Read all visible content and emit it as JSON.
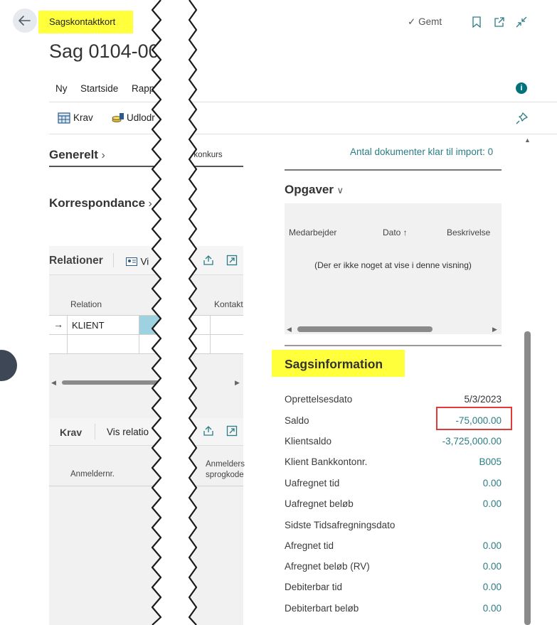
{
  "header": {
    "back_icon": "arrow-left-icon",
    "breadcrumb_label": "Sagskontaktkort",
    "title": "Sag 0104-00",
    "saved_label": "Gemt",
    "check_icon": "check-icon",
    "bookmark_icon": "bookmark-icon",
    "open_new_icon": "open-in-new-window-icon",
    "collapse_icon": "collapse-icon",
    "info_icon": "info-icon"
  },
  "nav": {
    "items": [
      "Ny",
      "Startside",
      "Rapp"
    ]
  },
  "actions": {
    "krav_label": "Krav",
    "udlodning_label": "Udlodr",
    "pin_icon": "pin-icon"
  },
  "sections": {
    "generelt": "Generelt",
    "korrespondance": "Korrespondance",
    "konkurs_fragment": "er konkurs"
  },
  "relationer": {
    "title": "Relationer",
    "vis_label": "Vi",
    "share_icon": "share-icon",
    "expand_icon": "expand-icon",
    "columns": [
      "Relation",
      "Kontakt"
    ],
    "rows": [
      {
        "relation": "KLIENT"
      }
    ]
  },
  "krav_section": {
    "title": "Krav",
    "vis_relation_label": "Vis relatio",
    "columns": [
      "Anmeldernr.",
      "Anmelders",
      "sprogkode"
    ]
  },
  "import_status": "Antal dokumenter klar til import: 0",
  "opgaver": {
    "title": "Opgaver",
    "columns": [
      "Medarbejder",
      "Dato ↑",
      "Beskrivelse"
    ],
    "empty_text": "(Der er ikke noget at vise i denne visning)"
  },
  "sagsinformation": {
    "title": "Sagsinformation",
    "fields": [
      {
        "label": "Oprettelsesdato",
        "value": "5/3/2023"
      },
      {
        "label": "Saldo",
        "value": "-75,000.00"
      },
      {
        "label": "Klientsaldo",
        "value": "-3,725,000.00"
      },
      {
        "label": "Klient Bankkontonr.",
        "value": "B005"
      },
      {
        "label": "Uafregnet tid",
        "value": "0.00"
      },
      {
        "label": "Uafregnet beløb",
        "value": "0.00"
      },
      {
        "label": "Sidste Tidsafregningsdato",
        "value": ""
      },
      {
        "label": "Afregnet tid",
        "value": "0.00"
      },
      {
        "label": "Afregnet beløb (RV)",
        "value": "0.00"
      },
      {
        "label": "Debiterbar tid",
        "value": "0.00"
      },
      {
        "label": "Debiterbart beløb",
        "value": "0.00"
      }
    ]
  },
  "colors": {
    "highlight": "#ffff3c",
    "accent": "#00727a",
    "annotation_box": "#e03a3a"
  }
}
